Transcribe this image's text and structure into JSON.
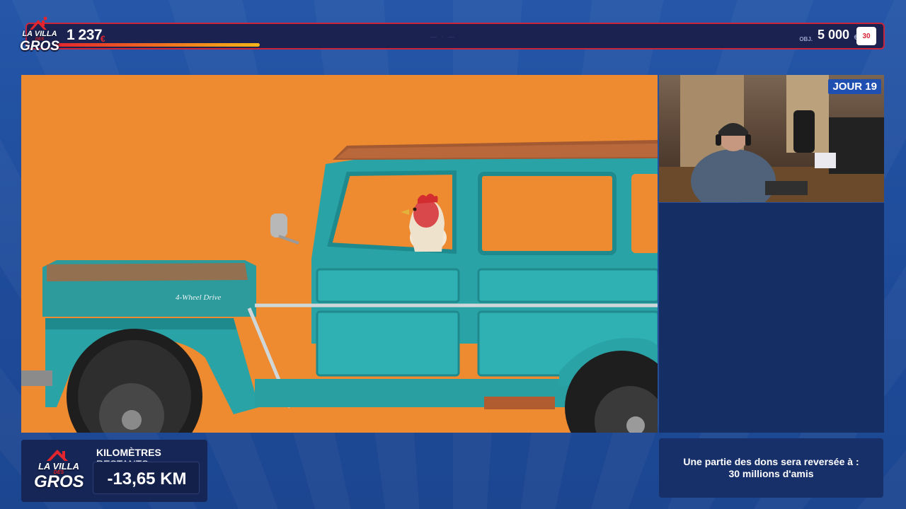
{
  "header": {
    "current_amount": "1 237",
    "current_currency": "€",
    "progress_fraction": 0.247,
    "center_decoration": "— · —",
    "goal_prefix": "OBJ.",
    "goal_amount": "5 000",
    "goal_currency": "€",
    "charity_badge_text": "30"
  },
  "logo": {
    "line1": "LA VILLA",
    "line2": "DES",
    "line3": "GROS"
  },
  "webcam": {
    "day_badge": "JOUR 19"
  },
  "km_panel": {
    "label_bold": "KILOMÈTRES",
    "label_rest": " RESTANTS :",
    "value": "-13,65 KM"
  },
  "donation_panel": {
    "line1": "Une partie des dons sera reversée à :",
    "line2": "30 millions d'amis"
  },
  "scene": {
    "vehicle_badge": "4-Wheel Drive"
  },
  "colors": {
    "accent_red": "#e3262e",
    "stage_orange": "#ee8a2f",
    "truck_teal": "#2aa7a8",
    "panel_navy": "#162656"
  }
}
